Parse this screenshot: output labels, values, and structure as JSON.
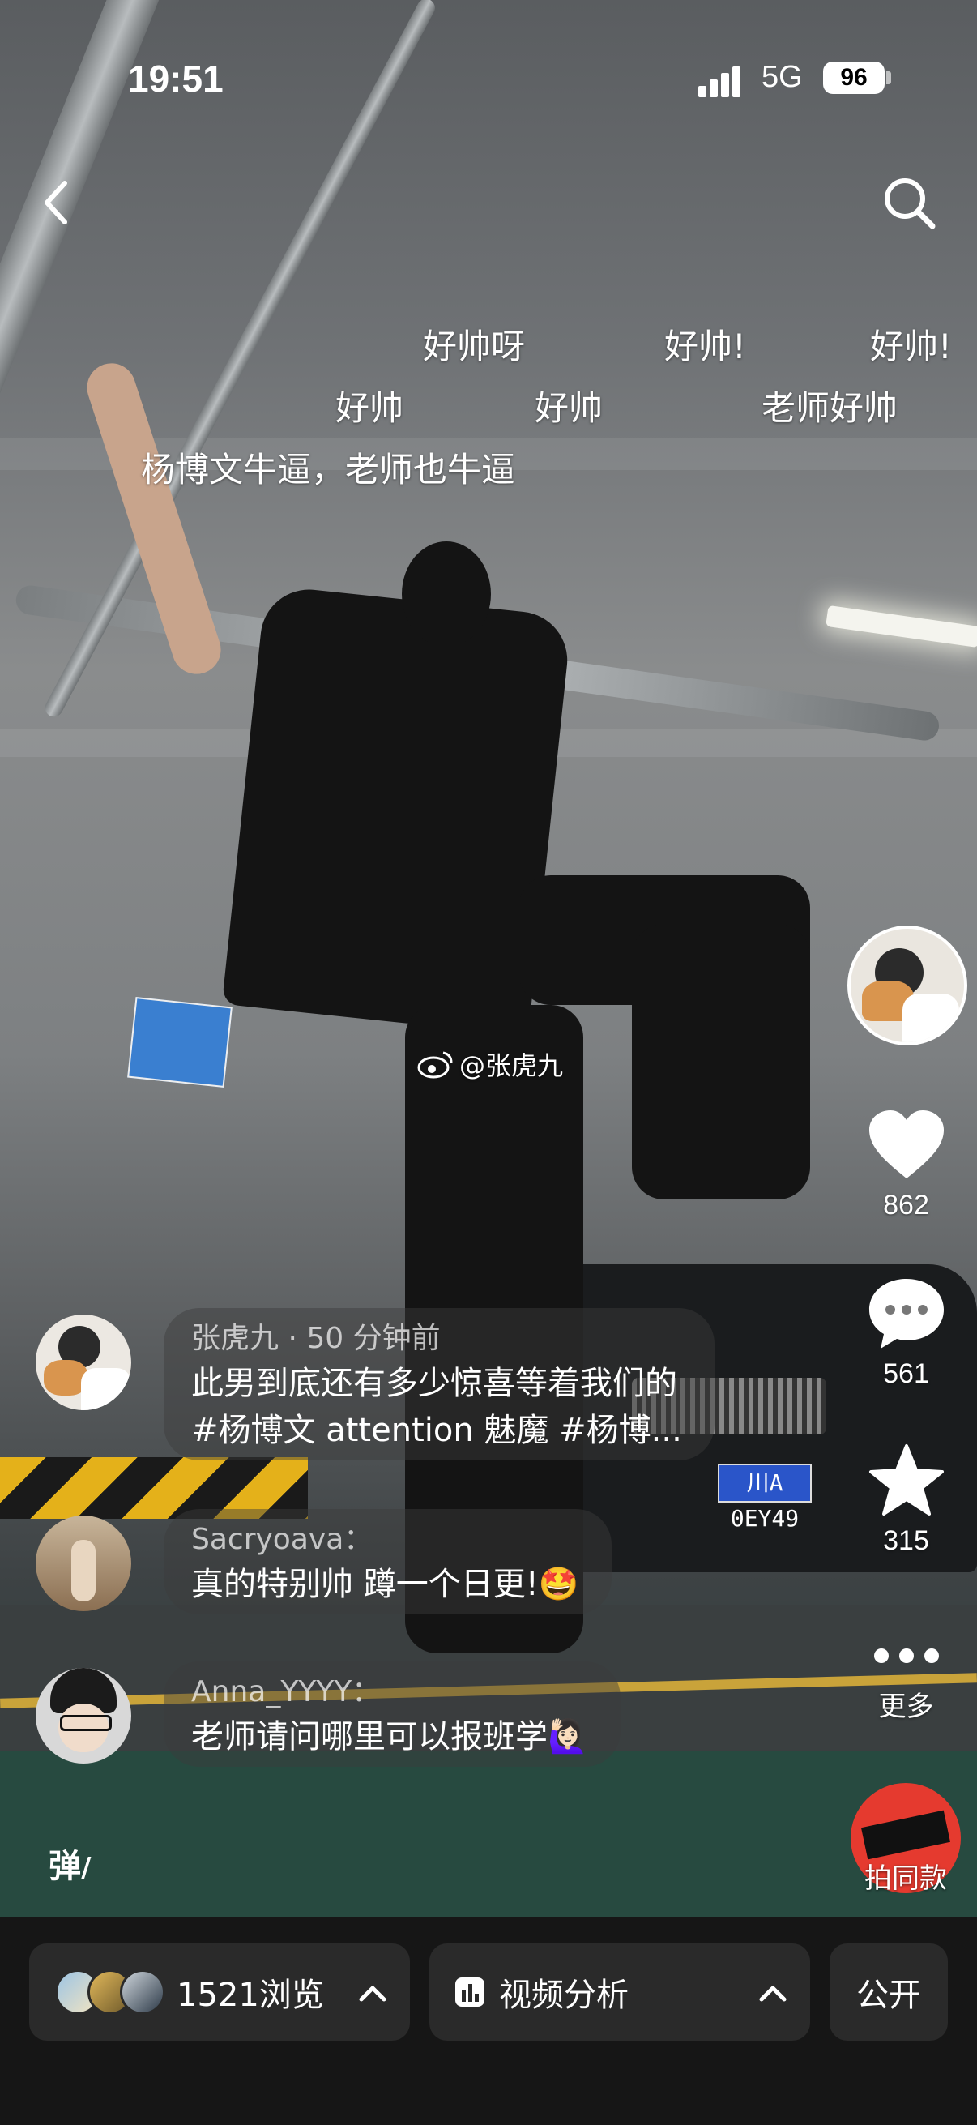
{
  "status_bar": {
    "time": "19:51",
    "network": "5G",
    "battery": "96"
  },
  "danmaku": [
    "好帅呀",
    "好帅!",
    "好帅!",
    "好帅",
    "好帅",
    "老师好帅",
    "杨博文牛逼，老师也牛逼"
  ],
  "watermark": "@张虎九",
  "side_actions": {
    "likes": "862",
    "comments": "561",
    "favorites": "315",
    "more_label": "更多",
    "same_style_label": "拍同款"
  },
  "comments": [
    {
      "name": "张虎九 · 50 分钟前",
      "text_line1": "此男到底还有多少惊喜等着我们的",
      "text_line2": "#杨博文 attention 魅魔 #杨博..."
    },
    {
      "name": "Sacryoava：",
      "text": "真的特别帅 蹲一个日更!🤩"
    },
    {
      "name": "Anna_YYYY：",
      "text": "老师请问哪里可以报班学🙋🏻‍♀️"
    }
  ],
  "danmu_toggle": "弹",
  "scene": {
    "plate_text": "川A 0EY49"
  },
  "bottom": {
    "views": "1521浏览",
    "analysis": "视频分析",
    "public": "公开"
  },
  "colors": {
    "background": "#161616",
    "pill": "#2a2a2a",
    "accent_red": "#e53a2f"
  }
}
